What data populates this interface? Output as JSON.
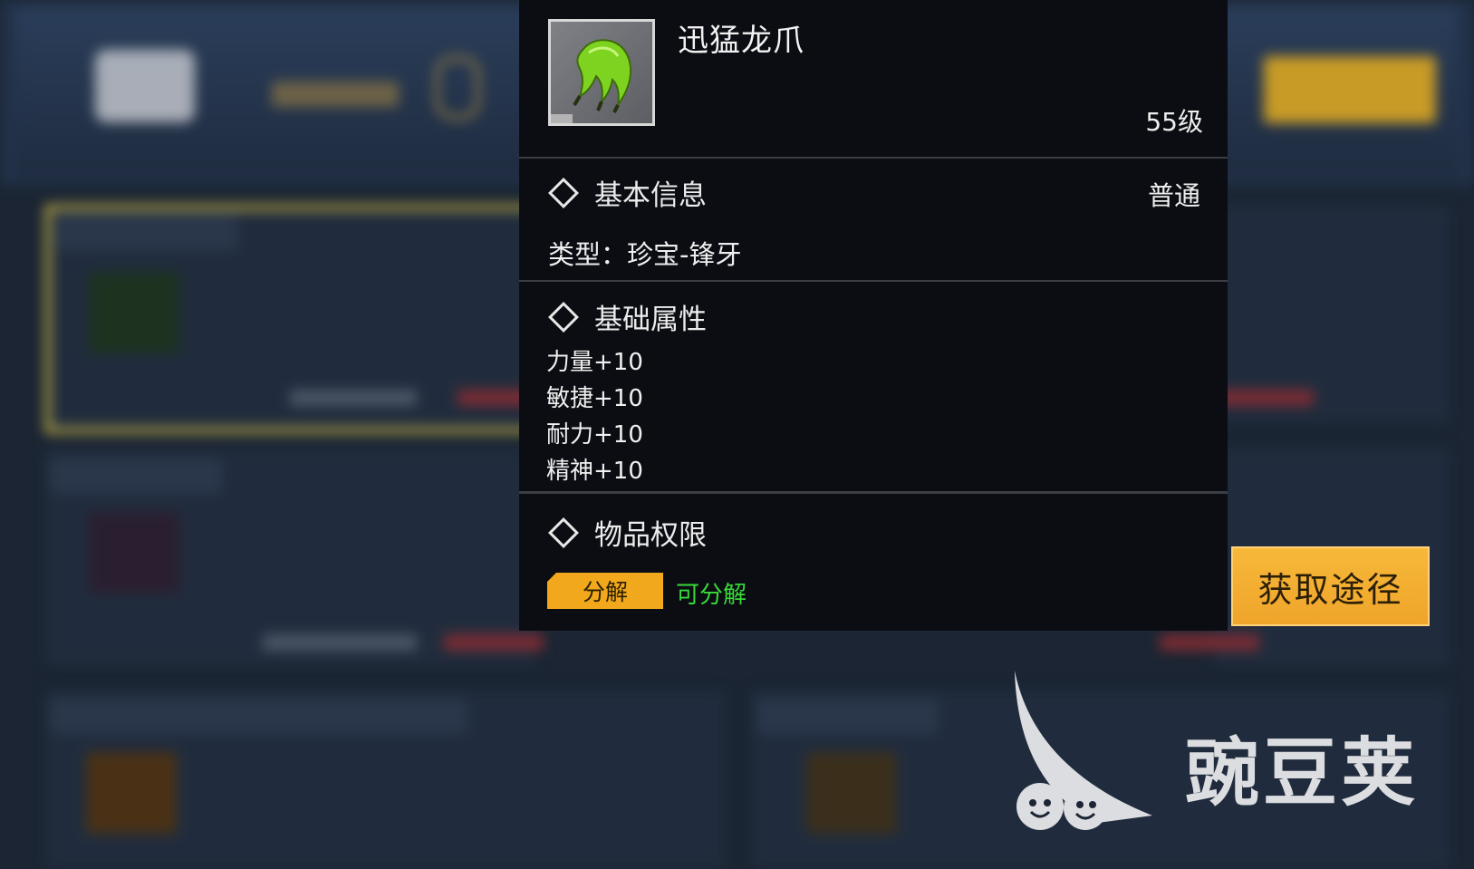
{
  "item": {
    "name": "迅猛龙爪",
    "level": "55级",
    "icon": "dragon-claw-icon"
  },
  "basic_info": {
    "title": "基本信息",
    "rarity": "普通",
    "type_line": "类型：珍宝-锋牙"
  },
  "attributes": {
    "title": "基础属性",
    "stats": [
      "力量+10",
      "敏捷+10",
      "耐力+10",
      "精神+10"
    ]
  },
  "permissions": {
    "title": "物品权限",
    "tag_label": "分解",
    "tag_status": "可分解"
  },
  "acquire_button": {
    "label": "获取途径"
  },
  "watermark": {
    "text": "豌豆荚"
  },
  "colors": {
    "tooltip_bg": "#0b0d12",
    "accent_orange": "#f2a81d",
    "status_green": "#38d93a",
    "background": "#1b2533"
  }
}
